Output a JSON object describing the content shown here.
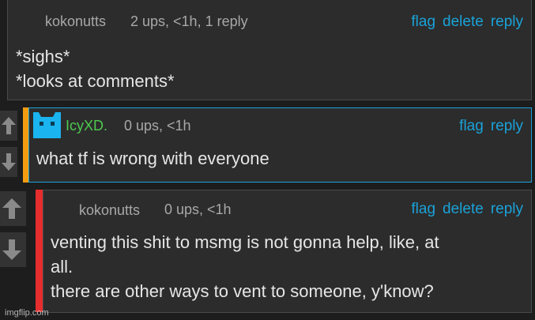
{
  "comments": [
    {
      "username": "kokonutts",
      "meta": "2 ups, <1h, 1 reply",
      "actions": [
        "flag",
        "delete",
        "reply"
      ],
      "lines": [
        "*sighs*",
        "*looks at comments*"
      ]
    },
    {
      "username": "IcyXD.",
      "meta": "0 ups, <1h",
      "actions": [
        "flag",
        "reply"
      ],
      "lines": [
        "what tf is wrong with everyone"
      ]
    },
    {
      "username": "kokonutts",
      "meta": "0 ups, <1h",
      "actions": [
        "flag",
        "delete",
        "reply"
      ],
      "lines": [
        "venting this shit to msmg is not gonna help, like, at",
        "all.",
        "there are other ways to vent to someone, y'know?"
      ]
    }
  ],
  "icons": {
    "upvote": "arrow-up-icon",
    "downvote": "arrow-down-icon",
    "avatar": "cat-face-avatar-icon"
  },
  "colors": {
    "link": "#1aa2d8",
    "username_green": "#4ec94e",
    "orange_bar": "#f39c12",
    "red_bar": "#e52d2d"
  },
  "watermark": "imgflip.com"
}
